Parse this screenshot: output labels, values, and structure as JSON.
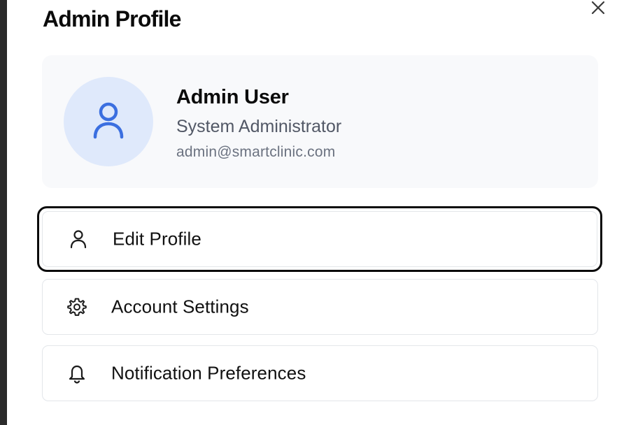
{
  "dialog": {
    "title": "Admin Profile",
    "close_icon": "close-icon"
  },
  "profile": {
    "avatar_icon": "user-icon",
    "name": "Admin User",
    "role": "System Administrator",
    "email": "admin@smartclinic.com"
  },
  "menu": {
    "items": [
      {
        "label": "Edit Profile",
        "icon": "user-icon",
        "focused": true
      },
      {
        "label": "Account Settings",
        "icon": "gear-icon",
        "focused": false
      },
      {
        "label": "Notification Preferences",
        "icon": "bell-icon",
        "focused": false
      }
    ]
  },
  "colors": {
    "avatar_bg": "#dfe9fb",
    "avatar_icon": "#3b6fe0",
    "card_bg": "#f8f9fb",
    "focus_ring": "#0b0b0b",
    "border": "#e3e6ea"
  }
}
